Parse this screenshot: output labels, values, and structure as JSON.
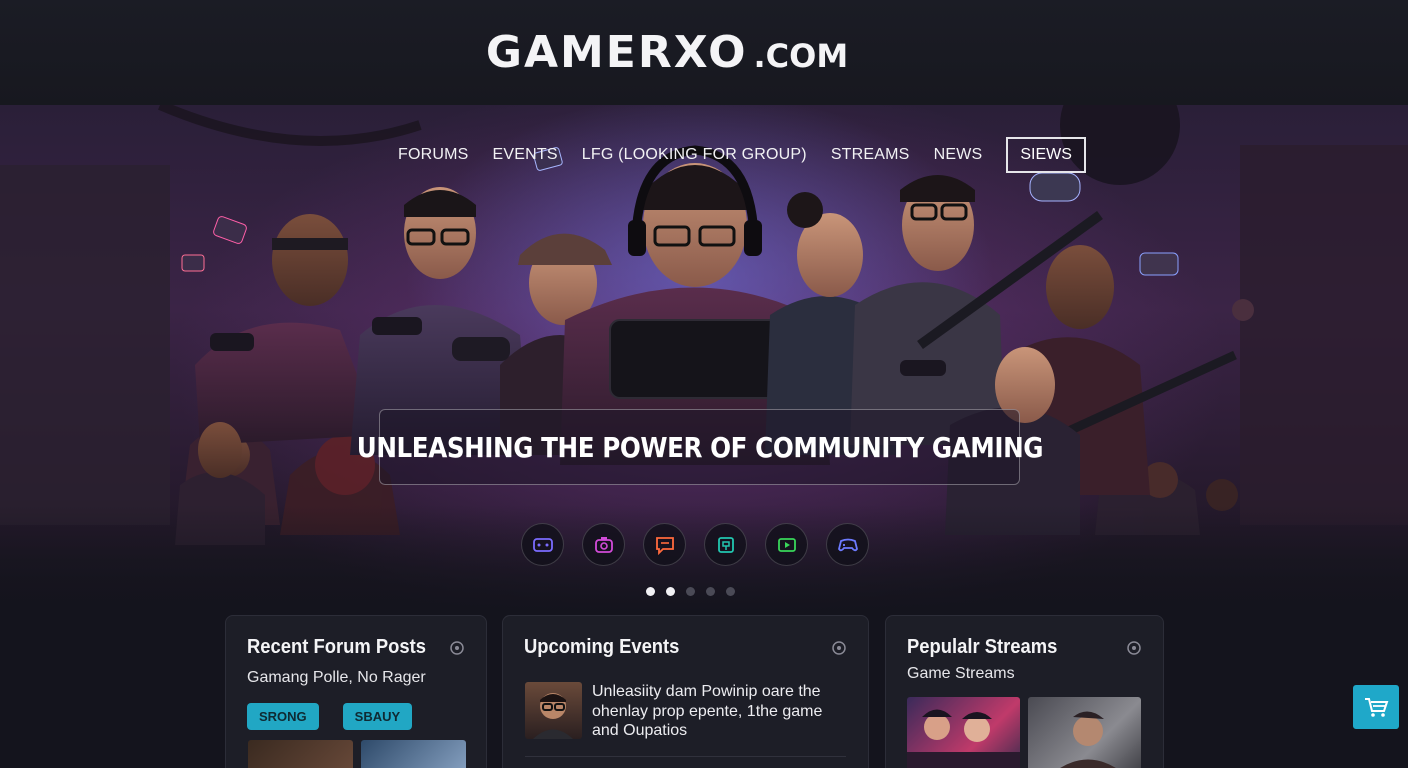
{
  "site": {
    "brand": "GAMERXO",
    "tld": ".COM"
  },
  "nav": {
    "items": [
      "FORUMS",
      "EVENTS",
      "LFG (LOOKING FOR GROUP)",
      "STREAMS",
      "NEWS"
    ],
    "button": "SIEWS"
  },
  "hero": {
    "tagline": "UNLEASHING THE POWER OF COMMUNITY GAMING",
    "icons": [
      {
        "name": "controller-icon",
        "color": "#7b6cff"
      },
      {
        "name": "camera-icon",
        "color": "#d24bd8"
      },
      {
        "name": "chat-icon",
        "color": "#ff6a3d"
      },
      {
        "name": "trophy-icon",
        "color": "#22c7b0"
      },
      {
        "name": "stream-icon",
        "color": "#39d65a"
      },
      {
        "name": "gamepad-icon",
        "color": "#6d7bff"
      }
    ],
    "slides_total": 5,
    "active_slide": 1
  },
  "cards": {
    "forum": {
      "title": "Recent Forum Posts",
      "subtitle": "Gamang Polle, No Rager",
      "tags": [
        "SRONG",
        "SBAUY"
      ]
    },
    "events": {
      "title": "Upcoming Events",
      "text": "Unleasiity dam Powinip oare the ohenlay prop epente, 1the game and Oupatios"
    },
    "streams": {
      "title": "Pepulalr Streams",
      "subtitle": "Game Streams"
    }
  },
  "colors": {
    "accent": "#21a7c4",
    "card_bg": "#1d1e27",
    "page_bg": "#14141d"
  }
}
